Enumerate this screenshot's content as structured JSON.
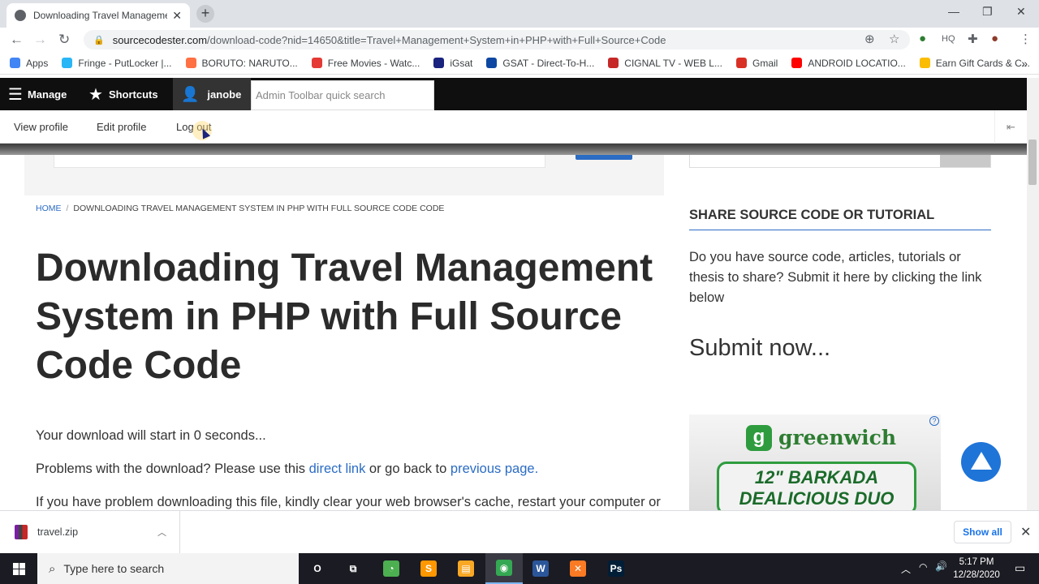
{
  "browser": {
    "tab_title": "Downloading Travel Managemen",
    "address": {
      "domain": "sourcecodester.com",
      "path": "/download-code?nid=14650&title=Travel+Management+System+in+PHP+with+Full+Source+Code"
    },
    "bookmarks": [
      {
        "label": "Apps",
        "color": "#4285f4",
        "icon": "apps-grid-icon"
      },
      {
        "label": "Fringe - PutLocker |...",
        "color": "#29b6f6",
        "icon": "play-icon"
      },
      {
        "label": "BORUTO: NARUTO...",
        "color": "#ff7043",
        "icon": "crunchyroll-icon"
      },
      {
        "label": "Free Movies - Watc...",
        "color": "#e53935",
        "icon": "play-circle-icon"
      },
      {
        "label": "iGsat",
        "color": "#1a237e",
        "icon": "igsat-icon"
      },
      {
        "label": "GSAT - Direct-To-H...",
        "color": "#0d47a1",
        "icon": "gsat-icon"
      },
      {
        "label": "CIGNAL TV - WEB L...",
        "color": "#c62828",
        "icon": "cignal-icon"
      },
      {
        "label": "Gmail",
        "color": "#d93025",
        "icon": "gmail-icon"
      },
      {
        "label": "ANDROID LOCATIO...",
        "color": "#ff0000",
        "icon": "youtube-icon"
      },
      {
        "label": "Earn Gift Cards & C...",
        "color": "#fbbc04",
        "icon": "gift-icon"
      }
    ],
    "more_bookmarks": "»"
  },
  "admin_toolbar": {
    "manage": "Manage",
    "shortcuts": "Shortcuts",
    "user": "janobe",
    "search_placeholder": "Admin Toolbar quick search",
    "tray_links": [
      "View profile",
      "Edit profile",
      "Log out"
    ]
  },
  "breadcrumb": {
    "home": "HOME",
    "separator": "/",
    "current": "DOWNLOADING TRAVEL MANAGEMENT SYSTEM IN PHP WITH FULL SOURCE CODE CODE"
  },
  "main": {
    "title": "Downloading Travel Management System in PHP with Full Source Code Code",
    "countdown": "Your download will start in 0 seconds...",
    "problems_prefix": "Problems with the download? Please use this",
    "direct_link": "direct link",
    "problems_middle": "or go back to",
    "previous_page": "previous page.",
    "cache_text": "If you have problem downloading this file, kindly clear your web browser's cache, restart your computer or"
  },
  "sidebar": {
    "heading": "SHARE SOURCE CODE OR TUTORIAL",
    "text": "Do you have source code, articles, tutorials or thesis to share? Submit it here by clicking the link below",
    "submit": "Submit now...",
    "ad": {
      "brand": "greenwich",
      "logo_letter": "g",
      "promo_line1": "12\" BARKADA",
      "promo_line2": "DEALICIOUS DUO",
      "badge": "?"
    }
  },
  "download_bar": {
    "filename": "travel.zip",
    "show_all": "Show all"
  },
  "taskbar": {
    "search_placeholder": "Type here to search",
    "time": "5:17 PM",
    "date": "12/28/2020",
    "apps": [
      {
        "name": "cortana",
        "label": "O",
        "color": "transparent"
      },
      {
        "name": "task-view",
        "label": "⧉",
        "color": "transparent"
      },
      {
        "name": "app-green",
        "label": "◔",
        "color": "#4caf50"
      },
      {
        "name": "sublime",
        "label": "S",
        "color": "#ff9800"
      },
      {
        "name": "file-explorer",
        "label": "▤",
        "color": "#f9a825"
      },
      {
        "name": "chrome",
        "label": "◉",
        "color": "#34a853"
      },
      {
        "name": "word",
        "label": "W",
        "color": "#2b579a"
      },
      {
        "name": "xampp",
        "label": "✕",
        "color": "#fb7a24"
      },
      {
        "name": "photoshop",
        "label": "Ps",
        "color": "#001e36"
      }
    ]
  }
}
